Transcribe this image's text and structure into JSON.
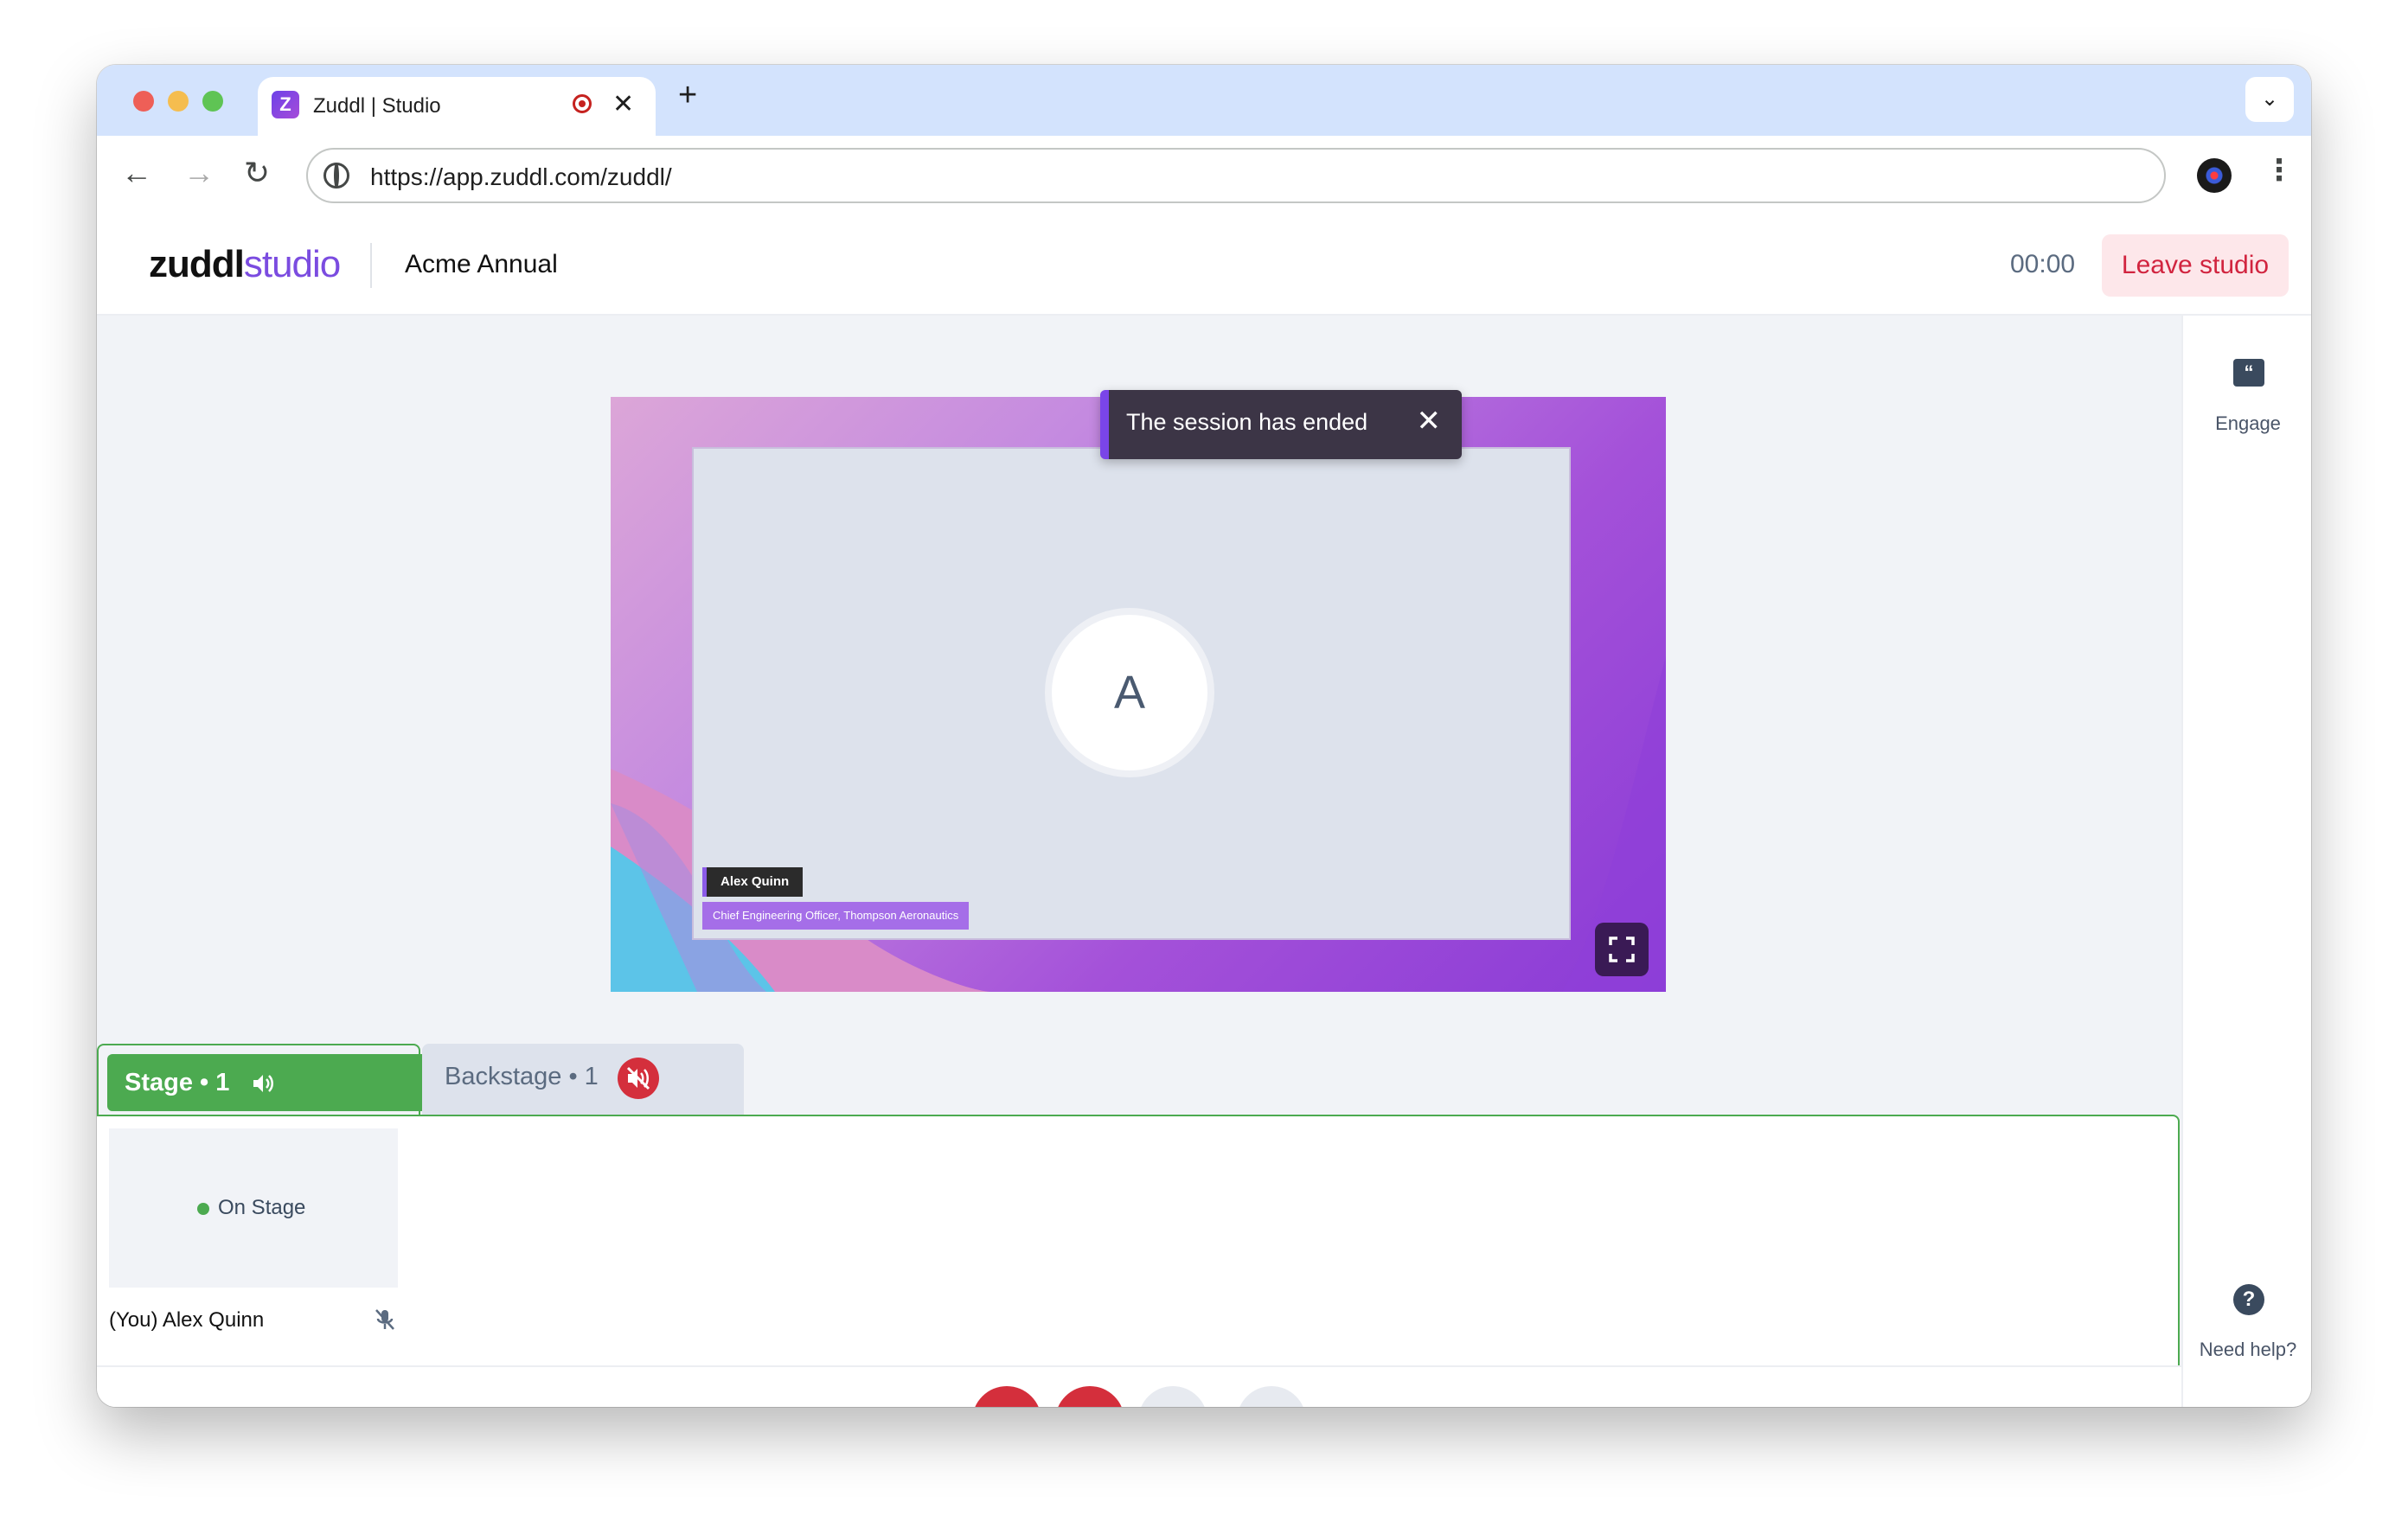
{
  "browser": {
    "tab_title": "Zuddl | Studio",
    "favicon_letter": "Z",
    "url": "https://app.zuddl.com/zuddl/"
  },
  "header": {
    "logo_main": "zuddl",
    "logo_sub": "studio",
    "event_title": "Acme Annual",
    "timer": "00:00",
    "leave_label": "Leave studio"
  },
  "stage": {
    "avatar_initial": "A",
    "speaker_name": "Alex Quinn",
    "speaker_title": "Chief Engineering Officer, Thompson Aeronautics",
    "toast_text": "The session has ended"
  },
  "tabs": {
    "stage_label": "Stage • 1",
    "backstage_label": "Backstage • 1"
  },
  "participants": [
    {
      "status": "On Stage",
      "name": "(You) Alex Quinn"
    }
  ],
  "rail": {
    "engage_label": "Engage",
    "help_label": "Need help?"
  },
  "colors": {
    "accent": "#7b4ce0",
    "stage_green": "#4caa50",
    "danger": "#d42f3c"
  }
}
